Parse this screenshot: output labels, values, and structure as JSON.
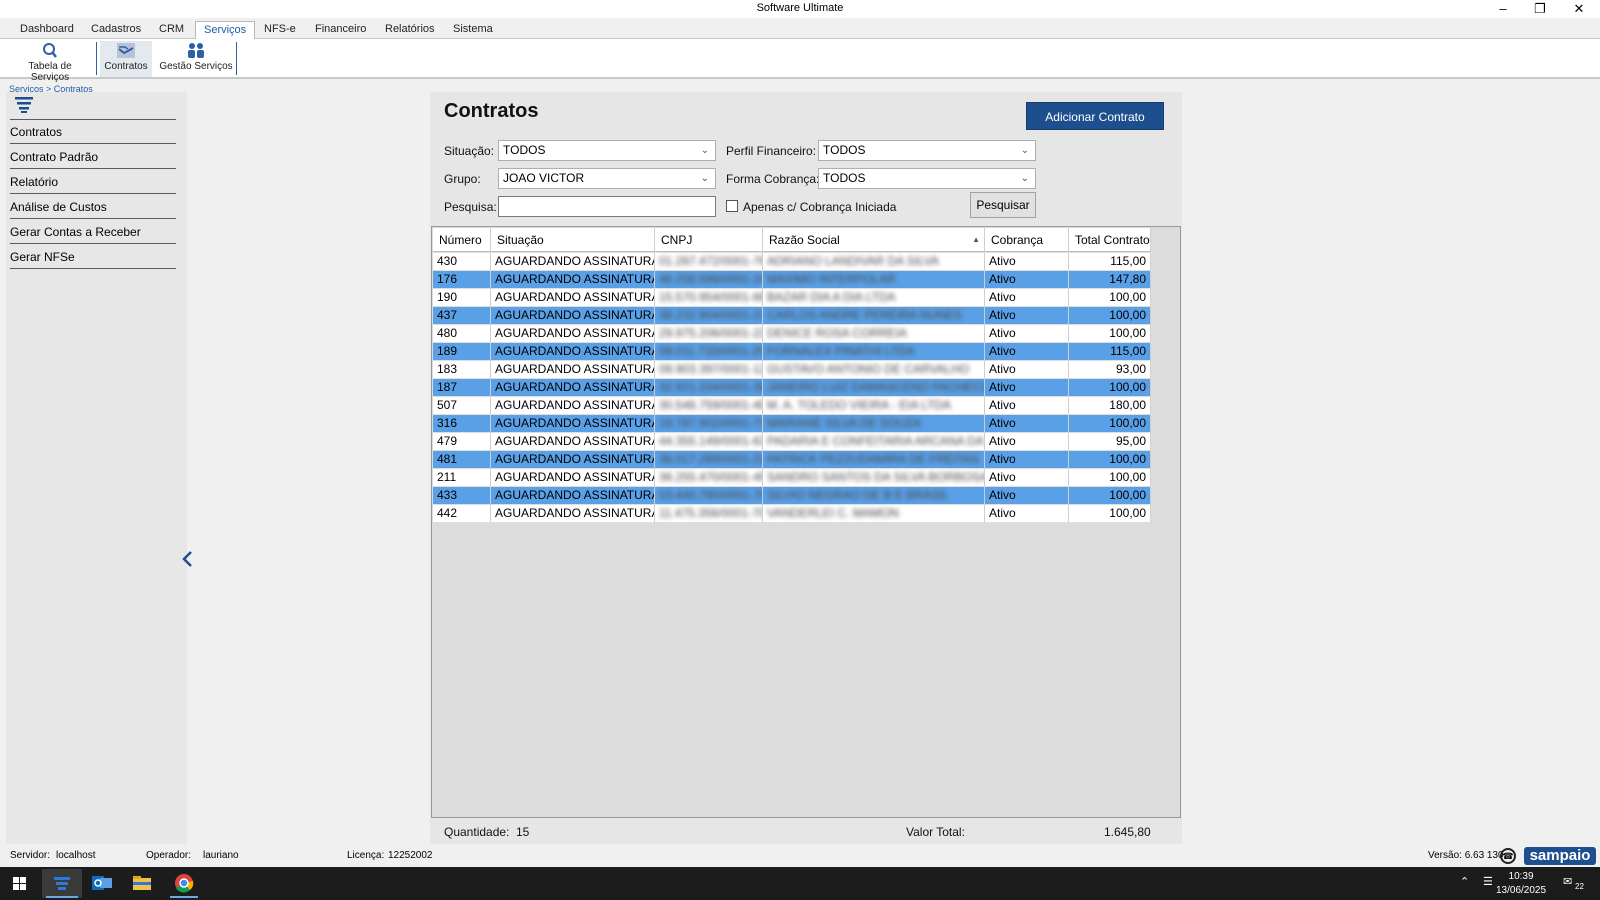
{
  "window": {
    "title": "Software Ultimate"
  },
  "menu": {
    "tabs": [
      "Dashboard",
      "Cadastros",
      "CRM",
      "Serviços",
      "NFS-e",
      "Financeiro",
      "Relatórios",
      "Sistema"
    ],
    "active": "Serviços"
  },
  "ribbon": {
    "buttons": [
      "Tabela de Serviços",
      "Contratos",
      "Gestão Serviços"
    ]
  },
  "breadcrumb": "Serviços > Contratos",
  "sidebar": {
    "items": [
      "Contratos",
      "Contrato Padrão",
      "Relatório",
      "Análise de Custos",
      "Gerar Contas a Receber",
      "Gerar NFSe"
    ]
  },
  "page": {
    "title": "Contratos",
    "add_button": "Adicionar Contrato",
    "filters": {
      "situacao_label": "Situação:",
      "situacao_value": "TODOS",
      "perfil_label": "Perfil Financeiro:",
      "perfil_value": "TODOS",
      "grupo_label": "Grupo:",
      "grupo_value": "JOAO VICTOR",
      "forma_label": "Forma Cobrança:",
      "forma_value": "TODOS",
      "pesquisa_label": "Pesquisa:",
      "pesquisa_value": "",
      "checkbox_label": "Apenas c/ Cobrança Iniciada",
      "search_button": "Pesquisar"
    }
  },
  "table": {
    "columns": [
      "Número",
      "Situação",
      "CNPJ",
      "Razão Social",
      "Cobrança",
      "Total Contrato"
    ],
    "rows": [
      {
        "numero": "430",
        "situacao": "AGUARDANDO ASSINATURA",
        "cnpj": "01.287.472/0001-76",
        "razao": "ADRIANO LANDIVAR DA SILVA",
        "cobranca": "Ativo",
        "total": "115,00"
      },
      {
        "numero": "176",
        "situacao": "AGUARDANDO ASSINATURA",
        "cnpj": "46.258.599/0001-24",
        "razao": "MAXIMO INTERPOLAR",
        "cobranca": "Ativo",
        "total": "147,80"
      },
      {
        "numero": "190",
        "situacao": "AGUARDANDO ASSINATURA",
        "cnpj": "15.570.954/0001-66",
        "razao": "BAZAR DIA A DIA LTDA",
        "cobranca": "Ativo",
        "total": "100,00"
      },
      {
        "numero": "437",
        "situacao": "AGUARDANDO ASSINATURA",
        "cnpj": "38.232.904/0001-21",
        "razao": "CARLOS ANDRE PEREIRA NUNES",
        "cobranca": "Ativo",
        "total": "100,00"
      },
      {
        "numero": "480",
        "situacao": "AGUARDANDO ASSINATURA",
        "cnpj": "29.975.206/0001-22",
        "razao": "DENICE ROSA CORREIA",
        "cobranca": "Ativo",
        "total": "100,00"
      },
      {
        "numero": "189",
        "situacao": "AGUARDANDO ASSINATURA",
        "cnpj": "08.011.733/0001-20",
        "razao": "FORNALEX PINATHI LTDA",
        "cobranca": "Ativo",
        "total": "115,00"
      },
      {
        "numero": "183",
        "situacao": "AGUARDANDO ASSINATURA",
        "cnpj": "09.903.397/0001-12",
        "razao": "GUSTAVO ANTONIO DE CARVALHO",
        "cobranca": "Ativo",
        "total": "93,00"
      },
      {
        "numero": "187",
        "situacao": "AGUARDANDO ASSINATURA",
        "cnpj": "32.921.334/0001-38",
        "razao": "JANEIRO LUIZ DAMASCENO PACHECO",
        "cobranca": "Ativo",
        "total": "100,00"
      },
      {
        "numero": "507",
        "situacao": "AGUARDANDO ASSINATURA",
        "cnpj": "30.546.759/0001-40",
        "razao": "M. A. TOLEDO VIEIRA - EIA LTDA",
        "cobranca": "Ativo",
        "total": "180,00"
      },
      {
        "numero": "316",
        "situacao": "AGUARDANDO ASSINATURA",
        "cnpj": "19.787.902/0001-73",
        "razao": "MARIANE SILVA DE SOUZA",
        "cobranca": "Ativo",
        "total": "100,00"
      },
      {
        "numero": "479",
        "situacao": "AGUARDANDO ASSINATURA",
        "cnpj": "44.355.149/0001-63",
        "razao": "PADARIA E CONFEITARIA ARCANA DA SI",
        "cobranca": "Ativo",
        "total": "95,00"
      },
      {
        "numero": "481",
        "situacao": "AGUARDANDO ASSINATURA",
        "cnpj": "36.017.289/0001-22",
        "razao": "PATRICK PEZZUDAMIRA DE FREITAS",
        "cobranca": "Ativo",
        "total": "100,00"
      },
      {
        "numero": "211",
        "situacao": "AGUARDANDO ASSINATURA",
        "cnpj": "36.255.470/0001-45",
        "razao": "SANDRO SANTOS DA SILVA BORBOSA",
        "cobranca": "Ativo",
        "total": "100,00"
      },
      {
        "numero": "433",
        "situacao": "AGUARDANDO ASSINATURA",
        "cnpj": "03.440.790/0001-76",
        "razao": "SILVIO NEGRAO DE B E BRASIL",
        "cobranca": "Ativo",
        "total": "100,00"
      },
      {
        "numero": "442",
        "situacao": "AGUARDANDO ASSINATURA",
        "cnpj": "11.475.356/0001-70",
        "razao": "VANDERLEI C. MAMON",
        "cobranca": "Ativo",
        "total": "100,00"
      }
    ]
  },
  "footer": {
    "quantidade_label": "Quantidade:",
    "quantidade": "15",
    "valor_label": "Valor Total:",
    "valor": "1.645,80"
  },
  "statusbar": {
    "servidor_label": "Servidor:",
    "servidor": "localhost",
    "operador_label": "Operador:",
    "operador": "lauriano",
    "licenca_label": "Licença:",
    "licenca": "12252002",
    "versao": "Versão: 6.63 130",
    "brand": "sampaio"
  },
  "taskbar": {
    "time": "10:39",
    "date": "13/06/2025",
    "notifications": "22"
  },
  "colors": {
    "accent": "#1d4f8f",
    "row_alt": "#5aa0e6",
    "row": "#ffffff"
  }
}
